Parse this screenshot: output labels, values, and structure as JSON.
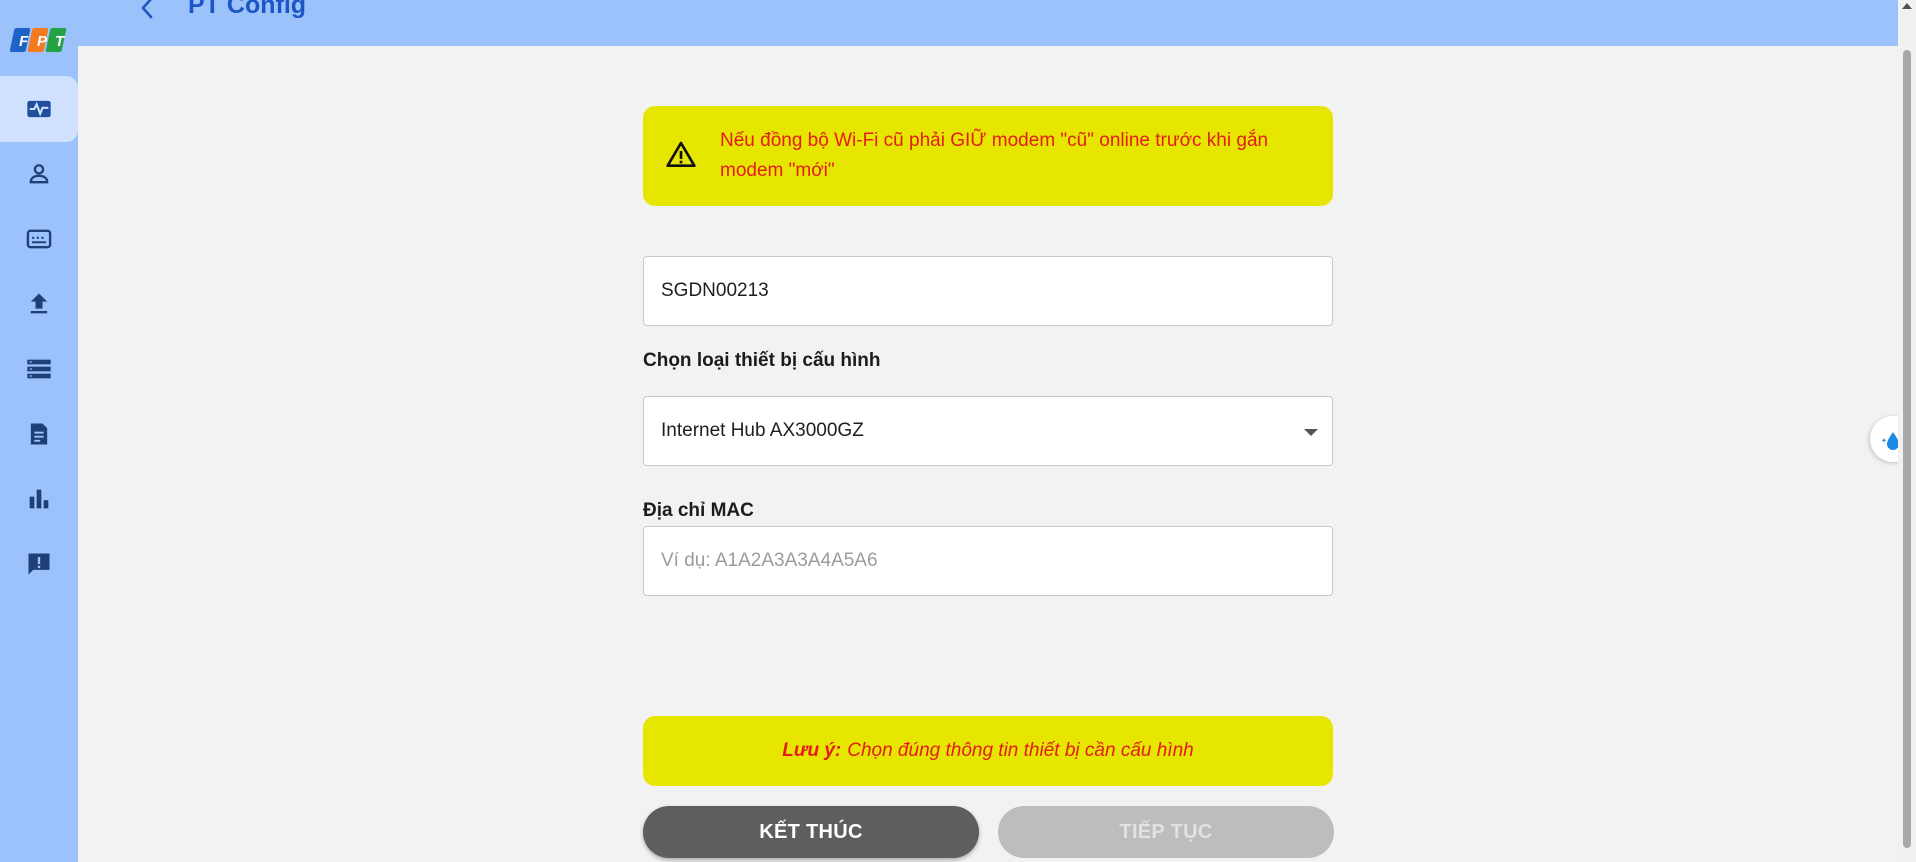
{
  "app": {
    "logo_text": "FPT"
  },
  "header": {
    "title": "PT Config"
  },
  "sidebar": {
    "items": [
      {
        "icon": "monitor-heartbeat-icon",
        "active": true
      },
      {
        "icon": "person-icon",
        "active": false
      },
      {
        "icon": "device-box-icon",
        "active": false
      },
      {
        "icon": "upload-icon",
        "active": false
      },
      {
        "icon": "list-storage-icon",
        "active": false
      },
      {
        "icon": "document-icon",
        "active": false
      },
      {
        "icon": "bar-chart-icon",
        "active": false
      },
      {
        "icon": "feedback-icon",
        "active": false
      }
    ]
  },
  "warning": {
    "text": "Nếu đồng bộ Wi-Fi cũ phải GIỮ modem \"cũ\" online trước khi gắn modem \"mới\""
  },
  "form": {
    "contract_value": "SGDN00213",
    "device_type_label": "Chọn loại thiết bị cấu hình",
    "device_type_value": "Internet Hub AX3000GZ",
    "mac_label": "Địa chỉ MAC",
    "mac_placeholder": "Ví dụ: A1A2A3A3A4A5A6"
  },
  "note": {
    "prefix": "Lưu ý:",
    "text": "Chọn đúng thông tin thiết bị cần cấu hình"
  },
  "buttons": {
    "finish": "KẾT THÚC",
    "next": "TIẾP TỤC"
  },
  "colors": {
    "sidebar_bg": "#9cc2fb",
    "accent_blue": "#1a56c4",
    "warning_bg": "#e6e600",
    "warning_text": "#e41c1c"
  }
}
